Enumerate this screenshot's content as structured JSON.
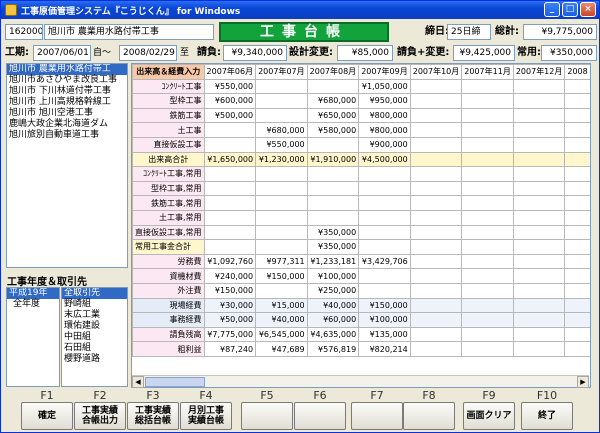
{
  "window": {
    "title": "工事原価管理システム『こうじくん』 for Windows",
    "ctrl_min": "_",
    "ctrl_max": "□",
    "ctrl_close": "×"
  },
  "header": {
    "code": "1620001",
    "name": "旭川市 農業用水路付帯工事",
    "banner": "工事台帳",
    "cutoff_label": "締日:",
    "cutoff_value": "25日締",
    "total_label": "総計:",
    "total_value": "¥9,775,000",
    "period_label": "工期:",
    "period_from": "2007/06/01",
    "period_mid": "自〜",
    "period_to": "2008/02/29",
    "period_end": "至",
    "contract_label": "請負:",
    "contract_value": "¥9,340,000",
    "change_label": "設計変更:",
    "change_value": "¥85,000",
    "contract_change_label": "請負+変更:",
    "contract_change_value": "¥9,425,000",
    "regular_label": "常用:",
    "regular_value": "¥350,000"
  },
  "projects": [
    "旭川市 農業用水路付帯工",
    "旭川市あさひやま改良工事",
    "旭川市 下川林道付帯工事",
    "旭川市 上川高規格幹線工",
    "旭川市 旭川空港工事",
    "鹿嶋大政企業北海道ダム",
    "旭川旅別自動車道工事"
  ],
  "year_section": {
    "label": "工事年度＆取引先",
    "years": [
      "平成19年",
      "全年度"
    ],
    "partners": [
      "全取引先",
      "野崎組",
      "末広工業",
      "環佑建設",
      "中田組",
      "石田組",
      "櫻野道路"
    ]
  },
  "grid": {
    "corner": "出来高＆経費入力",
    "months": [
      "2007年06月",
      "2007年07月",
      "2007年08月",
      "2007年09月",
      "2007年10月",
      "2007年11月",
      "2007年12月",
      "2008"
    ],
    "rows": [
      {
        "label": "ｺﾝｸﾘｰﾄ工事",
        "kind": "",
        "values": [
          "¥550,000",
          "",
          "",
          "¥1,050,000",
          "",
          "",
          "",
          ""
        ]
      },
      {
        "label": "型枠工事",
        "kind": "",
        "values": [
          "¥600,000",
          "",
          "¥680,000",
          "¥950,000",
          "",
          "",
          "",
          ""
        ]
      },
      {
        "label": "鉄筋工事",
        "kind": "",
        "values": [
          "¥500,000",
          "",
          "¥650,000",
          "¥800,000",
          "",
          "",
          "",
          ""
        ]
      },
      {
        "label": "土工事",
        "kind": "",
        "values": [
          "",
          "¥680,000",
          "¥580,000",
          "¥800,000",
          "",
          "",
          "",
          ""
        ]
      },
      {
        "label": "直接仮設工事",
        "kind": "",
        "values": [
          "",
          "¥550,000",
          "",
          "¥900,000",
          "",
          "",
          "",
          ""
        ]
      },
      {
        "label": "出来高合計",
        "kind": "hl",
        "values": [
          "¥1,650,000",
          "¥1,230,000",
          "¥1,910,000",
          "¥4,500,000",
          "",
          "",
          "",
          ""
        ]
      },
      {
        "label": "ｺﾝｸﾘｰﾄ工事,常用",
        "kind": "",
        "values": [
          "",
          "",
          "",
          "",
          "",
          "",
          "",
          ""
        ]
      },
      {
        "label": "型枠工事,常用",
        "kind": "",
        "values": [
          "",
          "",
          "",
          "",
          "",
          "",
          "",
          ""
        ]
      },
      {
        "label": "鉄筋工事,常用",
        "kind": "",
        "values": [
          "",
          "",
          "",
          "",
          "",
          "",
          "",
          ""
        ]
      },
      {
        "label": "土工事,常用",
        "kind": "",
        "values": [
          "",
          "",
          "",
          "",
          "",
          "",
          "",
          ""
        ]
      },
      {
        "label": "直接仮設工事,常用",
        "kind": "",
        "values": [
          "",
          "",
          "¥350,000",
          "",
          "",
          "",
          "",
          ""
        ]
      },
      {
        "label": "常用工事金合計",
        "kind": "total",
        "values": [
          "",
          "",
          "¥350,000",
          "",
          "",
          "",
          "",
          ""
        ]
      },
      {
        "label": "労務費",
        "kind": "",
        "values": [
          "¥1,092,760",
          "¥977,311",
          "¥1,233,181",
          "¥3,429,706",
          "",
          "",
          "",
          ""
        ]
      },
      {
        "label": "資機材費",
        "kind": "",
        "values": [
          "¥240,000",
          "¥150,000",
          "¥100,000",
          "",
          "",
          "",
          "",
          ""
        ]
      },
      {
        "label": "外注費",
        "kind": "",
        "values": [
          "¥150,000",
          "",
          "¥250,000",
          "",
          "",
          "",
          "",
          ""
        ]
      },
      {
        "label": "現場経費",
        "kind": "blue",
        "values": [
          "¥30,000",
          "¥15,000",
          "¥40,000",
          "¥150,000",
          "",
          "",
          "",
          ""
        ]
      },
      {
        "label": "事務経費",
        "kind": "blue",
        "values": [
          "¥50,000",
          "¥40,000",
          "¥60,000",
          "¥100,000",
          "",
          "",
          "",
          ""
        ]
      },
      {
        "label": "請負残高",
        "kind": "",
        "values": [
          "¥7,775,000",
          "¥6,545,000",
          "¥4,635,000",
          "¥135,000",
          "",
          "",
          "",
          ""
        ]
      },
      {
        "label": "粗利益",
        "kind": "",
        "values": [
          "¥87,240",
          "¥47,689",
          "¥576,819",
          "¥820,214",
          "",
          "",
          "",
          ""
        ]
      }
    ]
  },
  "fkeys": [
    {
      "key": "F1",
      "label": "確定"
    },
    {
      "key": "F2",
      "label": "工事実績\n合帳出力"
    },
    {
      "key": "F3",
      "label": "工事実績\n総括台帳"
    },
    {
      "key": "F4",
      "label": "月別工事\n実績台帳"
    },
    {
      "key": "F5",
      "label": ""
    },
    {
      "key": "F6",
      "label": ""
    },
    {
      "key": "F7",
      "label": ""
    },
    {
      "key": "F8",
      "label": ""
    },
    {
      "key": "F9",
      "label": "画面クリア"
    },
    {
      "key": "F10",
      "label": "終了"
    }
  ]
}
